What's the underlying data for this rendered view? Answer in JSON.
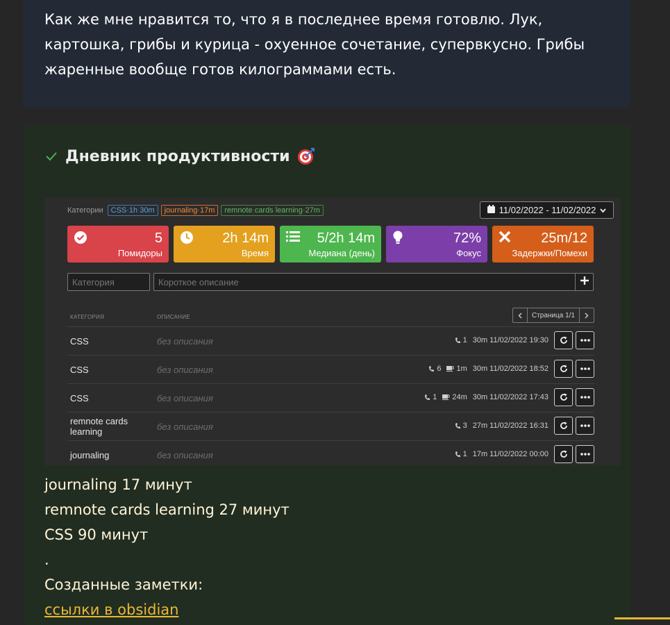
{
  "top_card": {
    "text": "Как же мне нравится то, что я в последнее время готовлю. Лук, картошка, грибы и курица - охуенное сочетание, супервкусно. Грибы жаренные вообще готов килограммами есть."
  },
  "productivity": {
    "title": "Дневник продуктивности",
    "icons": {
      "check": "check-icon",
      "target": "target-icon"
    },
    "app": {
      "categories_label": "Категории",
      "chips": [
        {
          "label": "CSS·1h 30m",
          "color": "#5aa0e6"
        },
        {
          "label": "journaling·17m",
          "color": "#ef8a3c"
        },
        {
          "label": "remnote cards learning·27m",
          "color": "#5cb85c"
        }
      ],
      "date_range": "11/02/2022 - 11/02/2022",
      "stats": [
        {
          "value": "5",
          "label": "Помидоры",
          "icon": "check-circle-icon",
          "color": "#d9434a"
        },
        {
          "value": "2h 14m",
          "label": "Время",
          "icon": "clock-icon",
          "color": "#e3a11f"
        },
        {
          "value": "5/2h 14m",
          "label": "Медиана (день)",
          "icon": "list-icon",
          "color": "#4eb64e"
        },
        {
          "value": "72%",
          "label": "Фокус",
          "icon": "lightbulb-icon",
          "color": "#7c3ea8"
        },
        {
          "value": "25m/12",
          "label": "Задержки/Помехи",
          "icon": "times-icon",
          "color": "#d45e1a"
        }
      ],
      "category_placeholder": "Категория",
      "description_placeholder": "Короткое описание",
      "table": {
        "headers": {
          "category": "КАТЕГОРИЯ",
          "description": "ОПИСАНИЕ"
        },
        "pager_label": "Страница 1/1",
        "rows": [
          {
            "category": "CSS",
            "description": "без описания",
            "calls": "1",
            "breaks": "",
            "duration": "30m",
            "datetime": "11/02/2022 19:30"
          },
          {
            "category": "CSS",
            "description": "без описания",
            "calls": "6",
            "breaks": "1m",
            "duration": "30m",
            "datetime": "11/02/2022 18:52"
          },
          {
            "category": "CSS",
            "description": "без описания",
            "calls": "1",
            "breaks": "24m",
            "duration": "30m",
            "datetime": "11/02/2022 17:43"
          },
          {
            "category": "remnote cards learning",
            "description": "без описания",
            "calls": "3",
            "breaks": "",
            "duration": "27m",
            "datetime": "11/02/2022 16:31"
          },
          {
            "category": "journaling",
            "description": "без описания",
            "calls": "1",
            "breaks": "",
            "duration": "17m",
            "datetime": "11/02/2022 00:00"
          }
        ]
      }
    },
    "notes": {
      "line1": "journaling 17 минут",
      "line2": "remnote cards learning 27 минут",
      "line3": "CSS 90 минут",
      "line4": ".",
      "line5": "Созданные заметки:",
      "link": "ссылки в obsidian"
    }
  }
}
